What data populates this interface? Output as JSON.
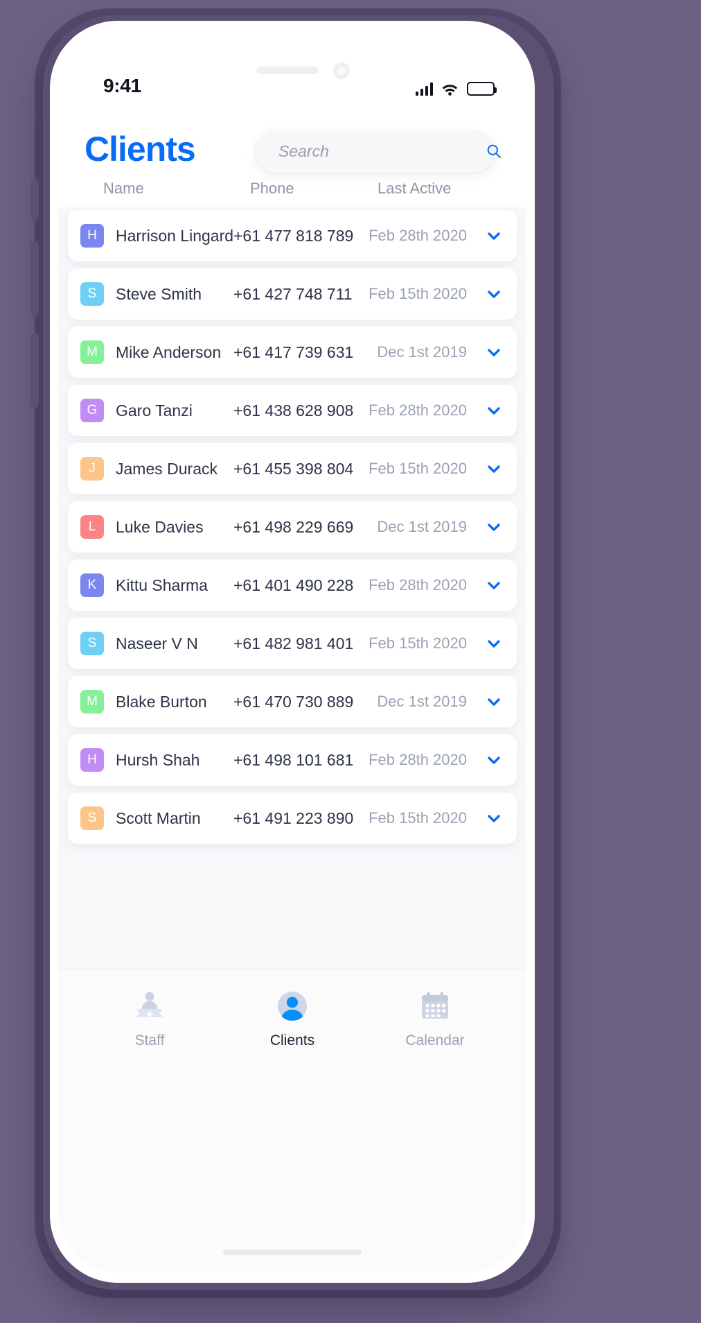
{
  "status_bar": {
    "time": "9:41",
    "icons": [
      "signal-icon",
      "wifi-icon",
      "battery-icon"
    ]
  },
  "header": {
    "title": "Clients",
    "title_color": "#0a6cf5"
  },
  "search": {
    "value": "",
    "placeholder": "Search",
    "icon": "search-icon"
  },
  "table": {
    "columns": [
      "Name",
      "Phone",
      "Last Active"
    ],
    "rows": [
      {
        "initial": "H",
        "color": "#7c86f0",
        "name": "Harrison Lingard",
        "phone": "+61 477 818 789",
        "last_active": "Feb 28th 2020"
      },
      {
        "initial": "S",
        "color": "#6fd0f5",
        "name": "Steve Smith",
        "phone": "+61 427 748 711",
        "last_active": "Feb 15th 2020"
      },
      {
        "initial": "M",
        "color": "#85f09a",
        "name": "Mike Anderson",
        "phone": "+61 417 739 631",
        "last_active": "Dec 1st 2019"
      },
      {
        "initial": "G",
        "color": "#c28cf5",
        "name": "Garo Tanzi",
        "phone": "+61 438 628 908",
        "last_active": "Feb 28th 2020"
      },
      {
        "initial": "J",
        "color": "#fcc58a",
        "name": "James Durack",
        "phone": "+61 455 398 804",
        "last_active": "Feb 15th 2020"
      },
      {
        "initial": "L",
        "color": "#fb8585",
        "name": "Luke Davies",
        "phone": "+61 498 229 669",
        "last_active": "Dec 1st 2019"
      },
      {
        "initial": "K",
        "color": "#7c86f0",
        "name": "Kittu Sharma",
        "phone": "+61 401 490 228",
        "last_active": "Feb 28th 2020"
      },
      {
        "initial": "S",
        "color": "#6fd0f5",
        "name": "Naseer V N",
        "phone": "+61 482 981 401",
        "last_active": "Feb 15th 2020"
      },
      {
        "initial": "M",
        "color": "#85f09a",
        "name": "Blake Burton",
        "phone": "+61 470 730 889",
        "last_active": "Dec 1st 2019"
      },
      {
        "initial": "H",
        "color": "#c28cf5",
        "name": "Hursh Shah",
        "phone": "+61 498 101 681",
        "last_active": "Feb 28th 2020"
      },
      {
        "initial": "S",
        "color": "#fcc58a",
        "name": "Scott Martin",
        "phone": "+61 491 223 890",
        "last_active": "Feb 15th 2020"
      }
    ],
    "row_expand_icon": "chevron-down-icon",
    "chevron_color": "#0a6cf5"
  },
  "tabbar": {
    "items": [
      {
        "label": "Staff",
        "icon": "staff-podium-icon",
        "active": false
      },
      {
        "label": "Clients",
        "icon": "person-circle-icon",
        "active": true
      },
      {
        "label": "Calendar",
        "icon": "calendar-icon",
        "active": false
      }
    ],
    "active_color": "#1d2435",
    "inactive_color": "#9aa2b2"
  }
}
